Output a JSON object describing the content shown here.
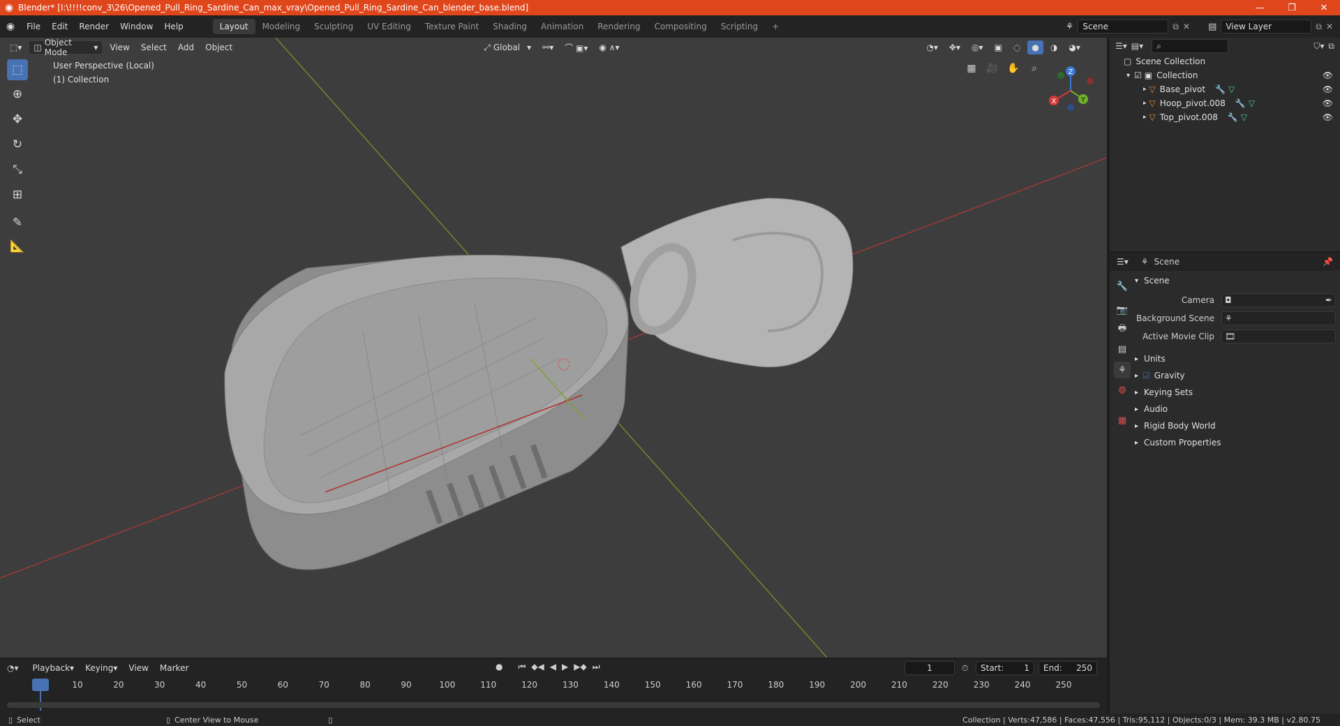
{
  "window": {
    "title": "Blender* [I:\\!!!!conv_3\\26\\Opened_Pull_Ring_Sardine_Can_max_vray\\Opened_Pull_Ring_Sardine_Can_blender_base.blend]",
    "minimize": "—",
    "maximize": "❐",
    "close": "✕"
  },
  "menu": {
    "items": [
      "File",
      "Edit",
      "Render",
      "Window",
      "Help"
    ]
  },
  "workspaces": [
    "Layout",
    "Modeling",
    "Sculpting",
    "UV Editing",
    "Texture Paint",
    "Shading",
    "Animation",
    "Rendering",
    "Compositing",
    "Scripting"
  ],
  "add_workspace": "+",
  "scene_selector": {
    "label": "Scene"
  },
  "view_layer": {
    "label": "View Layer"
  },
  "viewport": {
    "mode": "Object Mode",
    "menus": [
      "View",
      "Select",
      "Add",
      "Object"
    ],
    "orientation": "Global",
    "info_line1": "User Perspective (Local)",
    "info_line2": "(1) Collection",
    "gizmo": {
      "x": "X",
      "y": "Y",
      "z": "Z"
    }
  },
  "outliner": {
    "search_placeholder": "",
    "root": "Scene Collection",
    "collection": "Collection",
    "objects": [
      "Base_pivot",
      "Hoop_pivot.008",
      "Top_pivot.008"
    ]
  },
  "properties": {
    "header": "Scene",
    "section": "Scene",
    "fields": [
      {
        "label": "Camera",
        "value": ""
      },
      {
        "label": "Background Scene",
        "value": ""
      },
      {
        "label": "Active Movie Clip",
        "value": ""
      }
    ],
    "panels": [
      "Units",
      "Gravity",
      "Keying Sets",
      "Audio",
      "Rigid Body World",
      "Custom Properties"
    ],
    "gravity_checked": true
  },
  "timeline": {
    "menus": [
      "Playback",
      "Keying",
      "View",
      "Marker"
    ],
    "current_frame": "1",
    "start_label": "Start:",
    "start": "1",
    "end_label": "End:",
    "end": "250",
    "ticks": [
      "1",
      "10",
      "20",
      "30",
      "40",
      "50",
      "60",
      "70",
      "80",
      "90",
      "100",
      "110",
      "120",
      "130",
      "140",
      "150",
      "160",
      "170",
      "180",
      "190",
      "200",
      "210",
      "220",
      "230",
      "240",
      "250"
    ]
  },
  "status": {
    "left": "Select",
    "middle": "Center View to Mouse",
    "right": "Collection | Verts:47,586 | Faces:47,556 | Tris:95,112 | Objects:0/3 | Mem: 39.3 MB | v2.80.75"
  }
}
